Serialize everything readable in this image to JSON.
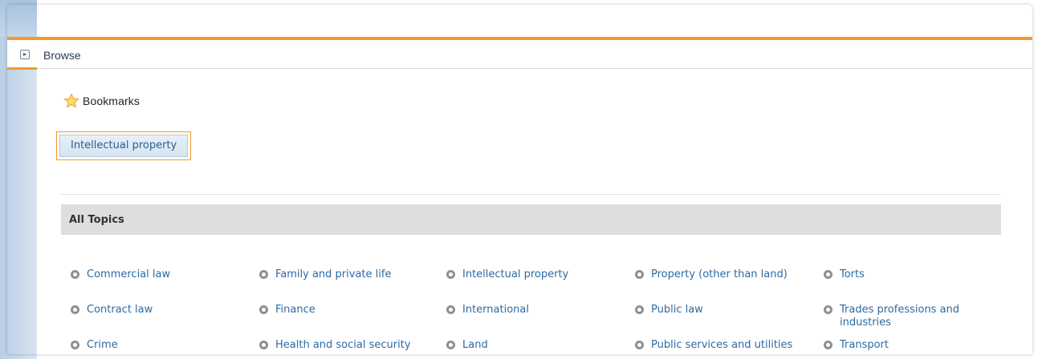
{
  "browse": {
    "label": "Browse",
    "toggle_icon": "expand-icon"
  },
  "bookmarks": {
    "title": "Bookmarks",
    "icon": "star-icon",
    "items": [
      {
        "label": "Intellectual property"
      }
    ]
  },
  "topics": {
    "title": "All Topics",
    "columns": [
      [
        "Commercial law",
        "Contract law",
        "Crime"
      ],
      [
        "Family and private life",
        "Finance",
        "Health and social security"
      ],
      [
        "Intellectual property",
        "International",
        "Land"
      ],
      [
        "Property (other than land)",
        "Public law",
        "Public services and utilities"
      ],
      [
        "Torts",
        "Trades professions and industries",
        "Transport"
      ]
    ]
  },
  "colors": {
    "accent": "#f09a2c",
    "link": "#2c6aa3",
    "header_bar": "#dedede"
  }
}
